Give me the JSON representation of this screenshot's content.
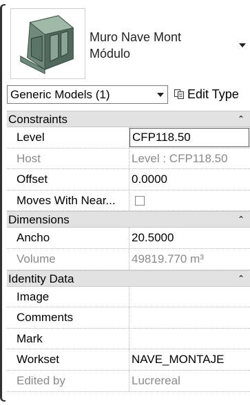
{
  "type_selector": {
    "family_name": "Muro Nave Mont",
    "type_name": "Módulo",
    "thumbnail_icon": "3d-model-thumbnail",
    "dropdown_icon": "triangle-down-icon"
  },
  "filter": {
    "selected": "Generic Models (1)",
    "edit_type_label": "Edit Type",
    "edit_type_icon": "edit-type-icon"
  },
  "sections": [
    {
      "title": "Constraints",
      "rows": [
        {
          "label": "Level",
          "value": "CFP118.50",
          "readonly": false,
          "editing": true
        },
        {
          "label": "Host",
          "value": "Level : CFP118.50",
          "readonly": true
        },
        {
          "label": "Offset",
          "value": "0.0000",
          "readonly": false
        },
        {
          "label": "Moves With Near...",
          "value": "",
          "checkbox": true,
          "checked": false
        }
      ]
    },
    {
      "title": "Dimensions",
      "rows": [
        {
          "label": "Ancho",
          "value": "20.5000",
          "readonly": false
        },
        {
          "label": "Volume",
          "value": "49819.770 m³",
          "readonly": true
        }
      ]
    },
    {
      "title": "Identity Data",
      "rows": [
        {
          "label": "Image",
          "value": ""
        },
        {
          "label": "Comments",
          "value": ""
        },
        {
          "label": "Mark",
          "value": ""
        },
        {
          "label": "Workset",
          "value": "NAVE_MONTAJE"
        },
        {
          "label": "Edited by",
          "value": "Lucrereal",
          "readonly": true
        }
      ]
    }
  ],
  "collapse_glyph": "⌃",
  "colors": {
    "section_bg": "#e2e2e2",
    "readonly_text": "#8a8a8a"
  }
}
